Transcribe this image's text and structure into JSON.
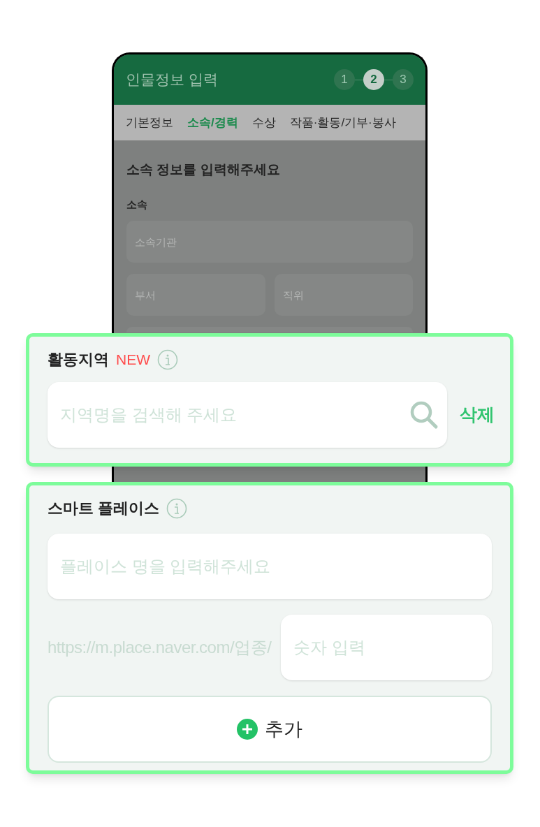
{
  "phone": {
    "title": "인물정보 입력",
    "steps": [
      {
        "label": "1",
        "selected": false
      },
      {
        "label": "2",
        "selected": true
      },
      {
        "label": "3",
        "selected": false
      }
    ],
    "tabs": [
      {
        "label": "기본정보",
        "selected": false
      },
      {
        "label": "소속/경력",
        "selected": true
      },
      {
        "label": "수상",
        "selected": false
      },
      {
        "label": "작품·활동/기부·봉사",
        "selected": false
      }
    ],
    "heading": "소속 정보를 입력해주세요",
    "section_label": "소속",
    "field_rows": [
      [
        {
          "placeholder": "소속기관"
        }
      ],
      [
        {
          "placeholder": "부서"
        },
        {
          "placeholder": "직위"
        }
      ]
    ]
  },
  "activity_region": {
    "label": "활동지역",
    "badge": "NEW",
    "search": {
      "placeholder": "지역명을 검색해 주세요"
    },
    "delete_link": "삭제"
  },
  "smart_place": {
    "label": "스마트 플레이스",
    "place_name": {
      "placeholder": "플레이스 명을 입력해주세요"
    },
    "url_prefix": "https://m.place.naver.com/업종/",
    "number": {
      "placeholder": "숫자 입력"
    },
    "add_button": "추가"
  }
}
